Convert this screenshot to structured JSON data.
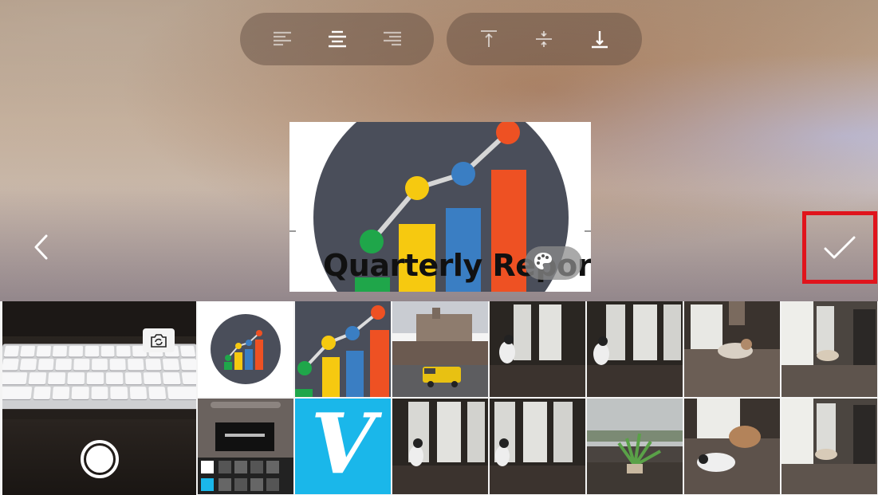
{
  "toolbar": {
    "horizontal_align": [
      {
        "icon": "align-left-icon"
      },
      {
        "icon": "align-center-icon",
        "active": true
      },
      {
        "icon": "align-right-icon"
      }
    ],
    "vertical_align": [
      {
        "icon": "align-top-icon"
      },
      {
        "icon": "align-middle-icon"
      },
      {
        "icon": "align-bottom-icon",
        "active": true
      }
    ]
  },
  "preview": {
    "title": "Quarterly Repor",
    "chart_colors": {
      "circle": "#4a4e5a",
      "green": "#1fa64a",
      "yellow": "#f6c910",
      "blue": "#3a7ec3",
      "orange": "#ee5123"
    }
  },
  "navigation": {
    "back_icon": "chevron-left-icon"
  },
  "confirm": {
    "icon": "checkmark-icon",
    "highlight_color": "#e0141c"
  },
  "camera": {
    "flip_icon": "camera-flip-icon",
    "shutter_icon": "shutter-icon"
  },
  "photos": {
    "vimeo_letter": "V",
    "thumbnail_subjects": [
      "quarterly-report-icon-thumb",
      "quarterly-report-cropped-thumb",
      "street-scene-with-yellow-van",
      "dog-at-window-1",
      "dog-at-window-2",
      "dog-on-couch-1",
      "room-with-bookshelf-1",
      "screenshot-thumb",
      "vimeo-logo",
      "dog-at-window-3",
      "dog-at-window-4",
      "plant-by-window",
      "dogs-on-couch-2",
      "room-with-bookshelf-2"
    ]
  }
}
